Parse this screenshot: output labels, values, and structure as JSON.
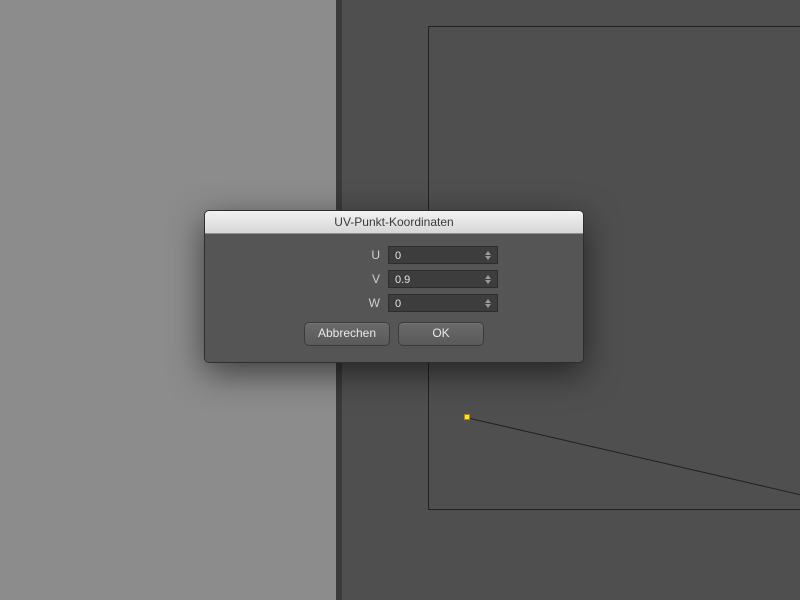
{
  "dialog": {
    "title": "UV-Punkt-Koordinaten",
    "fields": {
      "u": {
        "label": "U",
        "value": "0"
      },
      "v": {
        "label": "V",
        "value": "0.9"
      },
      "w": {
        "label": "W",
        "value": "0"
      }
    },
    "buttons": {
      "cancel": "Abbrechen",
      "ok": "OK"
    }
  },
  "canvas": {
    "selected_point_color": "#ffdf3a"
  }
}
